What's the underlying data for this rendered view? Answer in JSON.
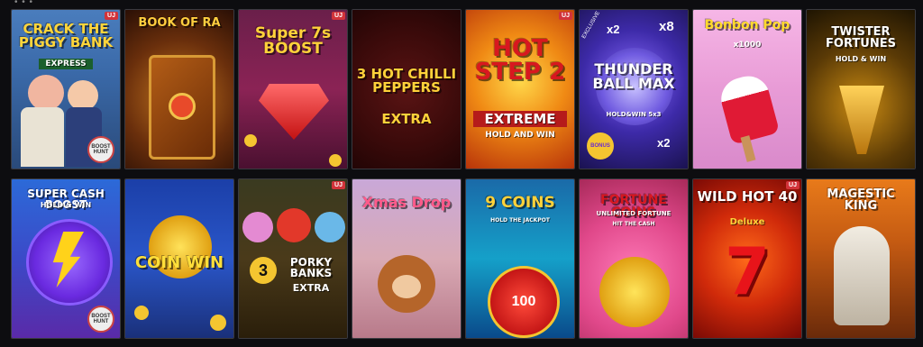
{
  "badge_label": "UJ",
  "games": [
    {
      "id": "crack-the-piggy-bank",
      "title": "CRACK THE PIGGY BANK",
      "subtitle": "EXPRESS",
      "corner": "BOOST HUNT",
      "badge": true
    },
    {
      "id": "book-of-ra",
      "title": "BOOK OF RA",
      "subtitle": "",
      "corner": "",
      "badge": false
    },
    {
      "id": "super-7s-boost",
      "title": "Super 7s BOOST",
      "subtitle": "",
      "corner": "",
      "badge": true
    },
    {
      "id": "3-hot-chilli-peppers",
      "title": "3 HOT CHILLI PEPPERS",
      "subtitle": "EXTRA",
      "corner": "",
      "badge": false
    },
    {
      "id": "hot-step-2",
      "title": "HOT STEP 2",
      "subtitle": "EXTREME",
      "extra": "HOLD AND WIN",
      "corner": "",
      "badge": true
    },
    {
      "id": "thunder-ball-max",
      "title": "THUNDER BALL MAX",
      "subtitle": "HOLD&WIN 5x3",
      "extra": "BONUS",
      "corner": "",
      "badge": false,
      "tag": "EXCLUSIVE",
      "mults": [
        "x2",
        "x8",
        "x2"
      ]
    },
    {
      "id": "bonbon-pop",
      "title": "Bonbon Pop",
      "subtitle": "x1000",
      "corner": "",
      "badge": false
    },
    {
      "id": "twister-fortunes",
      "title": "TWISTER FORTUNES",
      "subtitle": "HOLD & WIN",
      "corner": "",
      "badge": false
    },
    {
      "id": "super-cash-boost",
      "title": "SUPER CASH BOOST",
      "subtitle": "HOLD & WIN",
      "corner": "BOOST HUNT",
      "badge": false
    },
    {
      "id": "coin-win",
      "title": "COIN WIN",
      "subtitle": "",
      "corner": "",
      "badge": false
    },
    {
      "id": "3-porky-banks",
      "title": "PORKY BANKS",
      "subtitle": "EXTRA",
      "num": "3",
      "corner": "",
      "badge": true
    },
    {
      "id": "xmas-drop",
      "title": "Xmas Drop",
      "subtitle": "",
      "corner": "",
      "badge": false
    },
    {
      "id": "9-coins",
      "title": "9 COINS",
      "subtitle": "HOLD THE JACKPOT",
      "extra": "100",
      "corner": "",
      "badge": false
    },
    {
      "id": "fortune-coins",
      "title": "FORTUNE COINS",
      "subtitle": "UNLIMITED FORTUNE",
      "extra": "HIT THE CASH",
      "corner": "",
      "badge": false
    },
    {
      "id": "wild-hot-40-deluxe",
      "title": "WILD HOT 40",
      "subtitle": "Deluxe",
      "extra": "7",
      "corner": "",
      "badge": true
    },
    {
      "id": "majestic-king",
      "title": "MAGESTIC KING",
      "subtitle": "",
      "corner": "",
      "badge": false
    }
  ],
  "colors": {
    "page_bg": "#0d0d10",
    "badge": "#d2333a"
  }
}
